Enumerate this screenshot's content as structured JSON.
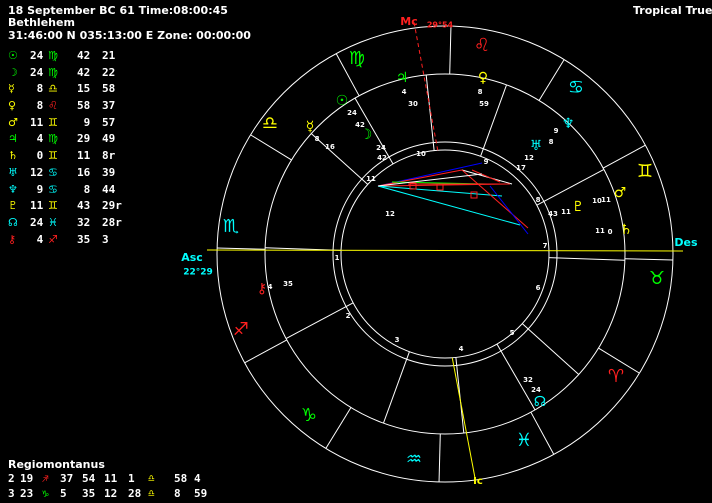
{
  "header": {
    "date_time": "18 September BC 61 Time:08:00:45",
    "place": "Bethlehem",
    "coords": "31:46:00 N 035:13:00 E Zone:  00:00:00",
    "zodiac": "Tropical True"
  },
  "colors": {
    "sun": "#00ff00",
    "moon": "#00ff00",
    "mercury": "#ffff00",
    "venus": "#ffff00",
    "mars": "#ffff00",
    "jupiter": "#00ff00",
    "saturn": "#ffff00",
    "uranus": "#00ffff",
    "neptune": "#00ffff",
    "pluto": "#ffff00",
    "node": "#00ffff",
    "chiron": "#ff2020",
    "virgo": "#00ff00",
    "leo": "#ff2020",
    "gemini": "#ffff00",
    "aquarius": "#00ffff",
    "libra": "#ffff00",
    "sagittarius": "#ff2020",
    "capricorn": "#00ff00",
    "pisces": "#00ffff",
    "cancer": "#00ffff",
    "taurus": "#00ff00",
    "aries": "#ff2020",
    "scorpio": "#00ffff"
  },
  "planets": [
    {
      "name": "sun",
      "glyph": "☉",
      "deg": "24",
      "sign": "virgo",
      "sign_glyph": "♍",
      "min": "42",
      "sec": "21"
    },
    {
      "name": "moon",
      "glyph": "☽",
      "deg": "24",
      "sign": "virgo",
      "sign_glyph": "♍",
      "min": "42",
      "sec": "22"
    },
    {
      "name": "mercury",
      "glyph": "☿",
      "deg": "8",
      "sign": "libra",
      "sign_glyph": "♎",
      "min": "15",
      "sec": "58"
    },
    {
      "name": "venus",
      "glyph": "♀",
      "deg": "8",
      "sign": "leo",
      "sign_glyph": "♌",
      "min": "58",
      "sec": "37"
    },
    {
      "name": "mars",
      "glyph": "♂",
      "deg": "11",
      "sign": "gemini",
      "sign_glyph": "♊",
      "min": "9",
      "sec": "57"
    },
    {
      "name": "jupiter",
      "glyph": "♃",
      "deg": "4",
      "sign": "virgo",
      "sign_glyph": "♍",
      "min": "29",
      "sec": "49"
    },
    {
      "name": "saturn",
      "glyph": "♄",
      "deg": "0",
      "sign": "gemini",
      "sign_glyph": "♊",
      "min": "11",
      "sec": "8r"
    },
    {
      "name": "uranus",
      "glyph": "♅",
      "deg": "12",
      "sign": "cancer",
      "sign_glyph": "♋",
      "min": "16",
      "sec": "39"
    },
    {
      "name": "neptune",
      "glyph": "♆",
      "deg": "9",
      "sign": "cancer",
      "sign_glyph": "♋",
      "min": "8",
      "sec": "44"
    },
    {
      "name": "pluto",
      "glyph": "♇",
      "deg": "11",
      "sign": "gemini",
      "sign_glyph": "♊",
      "min": "43",
      "sec": "29r"
    },
    {
      "name": "node",
      "glyph": "☊",
      "deg": "24",
      "sign": "pisces",
      "sign_glyph": "♓",
      "min": "32",
      "sec": "28r"
    },
    {
      "name": "chiron",
      "glyph": "⚷",
      "deg": "4",
      "sign": "sagittarius",
      "sign_glyph": "♐",
      "min": "35",
      "sec": "3"
    }
  ],
  "house_system": "Regiomontanus",
  "houses": [
    {
      "c1": "2",
      "c2": "19",
      "g1": "♐",
      "s1": "sagittarius",
      "c3": "37",
      "c4": "54",
      "c5": "11",
      "c6": "1",
      "g2": "♎",
      "s2": "libra",
      "c7": "58",
      "c8": "4"
    },
    {
      "c1": "3",
      "c2": "23",
      "g1": "♑",
      "s1": "capricorn",
      "c3": "5",
      "c4": "35",
      "c5": "12",
      "c6": "28",
      "g2": "♎",
      "s2": "libra",
      "c7": "8",
      "c8": "59"
    }
  ],
  "angles": {
    "mc_label": "Mc",
    "mc_deg": "29°54",
    "ic_label": "Ic",
    "asc_label": "Asc",
    "asc_deg": "22°29",
    "des_label": "Des"
  },
  "zodiac_ring": [
    {
      "name": "leo",
      "glyph": "♌"
    },
    {
      "name": "cancer",
      "glyph": "♋"
    },
    {
      "name": "gemini",
      "glyph": "♊"
    },
    {
      "name": "taurus",
      "glyph": "♉"
    },
    {
      "name": "aries",
      "glyph": "♈"
    },
    {
      "name": "pisces",
      "glyph": "♓"
    },
    {
      "name": "aquarius",
      "glyph": "♒"
    },
    {
      "name": "capricorn",
      "glyph": "♑"
    },
    {
      "name": "sagittarius",
      "glyph": "♐"
    },
    {
      "name": "scorpio",
      "glyph": "♏"
    },
    {
      "name": "libra",
      "glyph": "♎"
    },
    {
      "name": "virgo",
      "glyph": "♍"
    }
  ],
  "house_numbers": [
    "1",
    "2",
    "3",
    "4",
    "5",
    "6",
    "7",
    "8",
    "9",
    "10",
    "11",
    "12"
  ],
  "chart_planets": [
    {
      "name": "jupiter",
      "glyph": "♃",
      "deg": "4",
      "min": "30"
    },
    {
      "name": "venus",
      "glyph": "♀",
      "deg": "8",
      "min": "59"
    },
    {
      "name": "sun",
      "glyph": "☉",
      "deg": "24",
      "min": "42"
    },
    {
      "name": "mercury",
      "glyph": "☿",
      "deg": "8",
      "min": "16"
    },
    {
      "name": "moon",
      "glyph": "☽",
      "deg": "24",
      "min": "42"
    },
    {
      "name": "neptune",
      "glyph": "♆",
      "deg": "9",
      "min": "8"
    },
    {
      "name": "uranus",
      "glyph": "♅",
      "deg": "12",
      "min": "17"
    },
    {
      "name": "mars",
      "glyph": "♂",
      "deg": "11",
      "min": "10"
    },
    {
      "name": "pluto",
      "glyph": "♇",
      "deg": "11",
      "min": "43"
    },
    {
      "name": "saturn",
      "glyph": "♄",
      "deg": "0",
      "min": "11"
    },
    {
      "name": "chiron",
      "glyph": "⚷",
      "deg": "4",
      "min": "35"
    },
    {
      "name": "node",
      "glyph": "☊",
      "deg": "24",
      "min": "32"
    }
  ]
}
